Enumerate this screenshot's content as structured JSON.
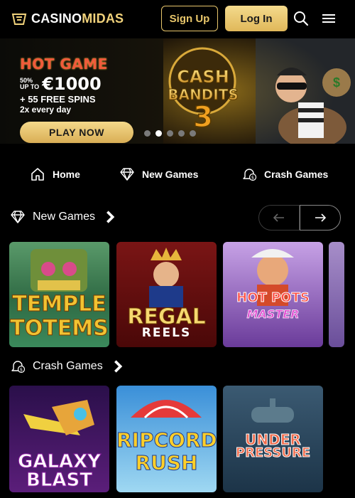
{
  "header": {
    "logo_prefix": "CASINO",
    "logo_accent": "MIDAS",
    "signup_label": "Sign Up",
    "login_label": "Log In",
    "icons": [
      "search-icon",
      "menu-icon"
    ],
    "accent_color": "#e8c66b"
  },
  "banner": {
    "hot_title": "HOT GAME",
    "offer_percent": "50%",
    "offer_upto": "UP TO",
    "offer_amount": "€1000",
    "offer_spins": "+ 55 FREE SPINS",
    "offer_frequency": "2x every day",
    "cta_label": "PLAY NOW",
    "featured_game_line1": "CASH",
    "featured_game_line2": "BANDITS",
    "featured_game_number": "3",
    "slides_total": 5,
    "active_slide": 2
  },
  "nav_tabs": [
    {
      "label": "Home",
      "icon": "home-icon"
    },
    {
      "label": "New Games",
      "icon": "diamond-icon"
    },
    {
      "label": "Crash Games",
      "icon": "bell-icon"
    }
  ],
  "sections": {
    "new_games": {
      "title": "New Games",
      "games": [
        {
          "line1": "TEMPLE",
          "line2": "TOTEMS"
        },
        {
          "line1": "REGAL",
          "line2": "REELS"
        },
        {
          "line1": "HOT POTS",
          "line2": "MASTER"
        }
      ]
    },
    "crash_games": {
      "title": "Crash Games",
      "games": [
        {
          "line1": "GALAXY",
          "line2": "BLAST"
        },
        {
          "line1": "RIPCORD",
          "line2": "RUSH"
        },
        {
          "line1": "UNDER",
          "line2": "PRESSURE"
        }
      ]
    }
  }
}
